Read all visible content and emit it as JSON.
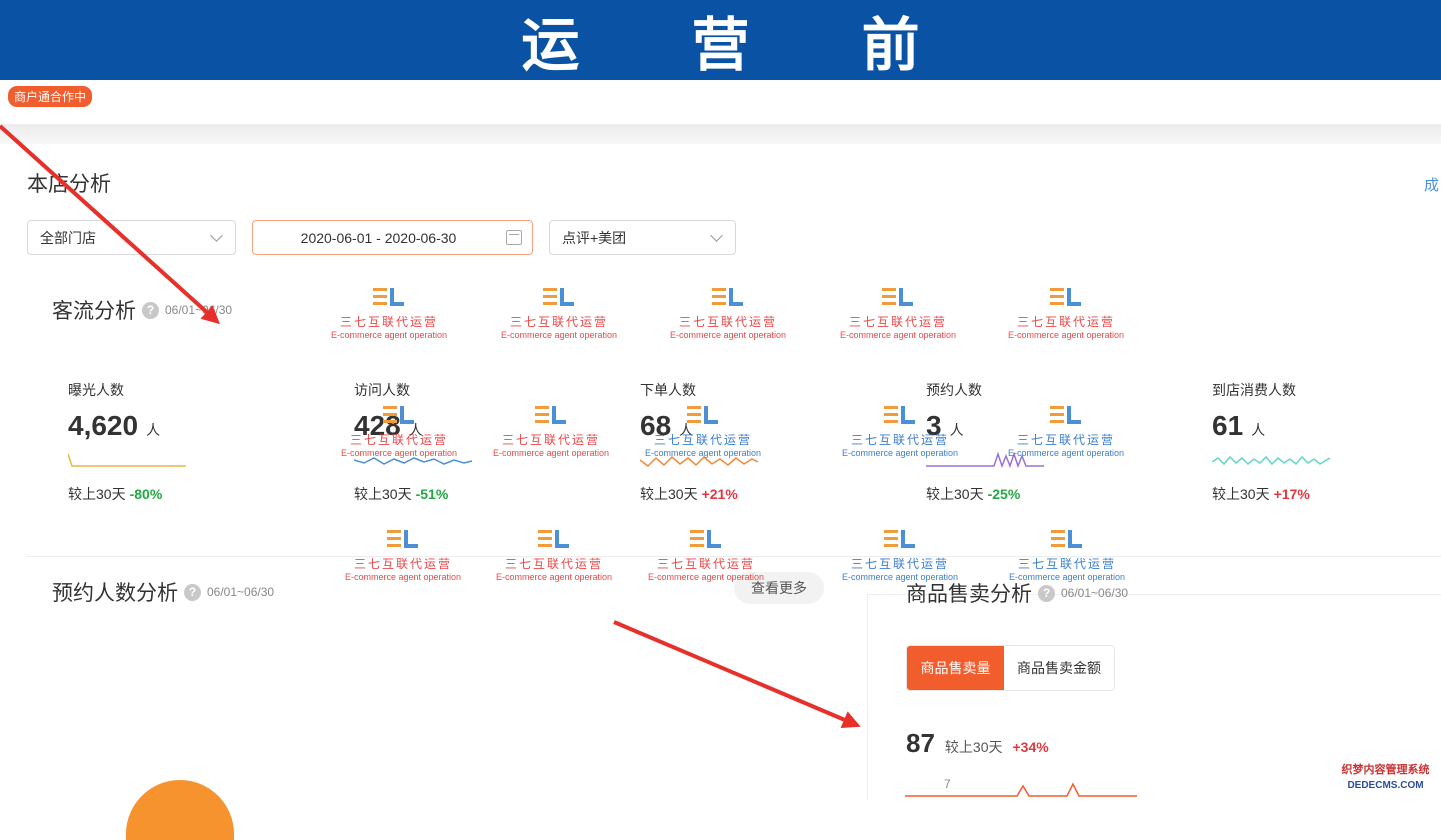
{
  "banner": {
    "title": "运 营 前"
  },
  "topbar": {
    "merchant_badge": "商户通合作中"
  },
  "store_analysis": {
    "title": "本店分析",
    "more_link": "成",
    "filters": {
      "store_select": "全部门店",
      "date_range": "2020-06-01 - 2020-06-30",
      "platform_select": "点评+美团"
    }
  },
  "traffic": {
    "title": "客流分析",
    "range": "06/01~06/30",
    "compare_label": "较上30天",
    "metrics": [
      {
        "label": "曝光人数",
        "value": "4,620",
        "unit": "人",
        "pct": "-80%",
        "trend": "neg",
        "color": "#e8b54a"
      },
      {
        "label": "访问人数",
        "value": "428",
        "unit": "人",
        "pct": "-51%",
        "trend": "neg",
        "color": "#4b8fd6"
      },
      {
        "label": "下单人数",
        "value": "68",
        "unit": "人",
        "pct": "+21%",
        "trend": "pos",
        "color": "#f08a3c"
      },
      {
        "label": "预约人数",
        "value": "3",
        "unit": "人",
        "pct": "-25%",
        "trend": "neg",
        "color": "#9b6fd6"
      },
      {
        "label": "到店消费人数",
        "value": "61",
        "unit": "人",
        "pct": "+17%",
        "trend": "pos",
        "color": "#5fd6c8"
      }
    ]
  },
  "booking": {
    "title": "预约人数分析",
    "range": "06/01~06/30",
    "view_more": "查看更多"
  },
  "product_sales": {
    "title": "商品售卖分析",
    "range": "06/01~06/30",
    "tabs": [
      "商品售卖量",
      "商品售卖金额"
    ],
    "value": "87",
    "compare_label": "较上30天",
    "pct": "+34%",
    "axis_tick": "7"
  },
  "watermark": {
    "cn": "三七互联代运营",
    "en": "E-commerce agent operation"
  },
  "footer_watermark": {
    "cn": "织梦内容管理系统",
    "en": "DEDECMS.COM"
  }
}
